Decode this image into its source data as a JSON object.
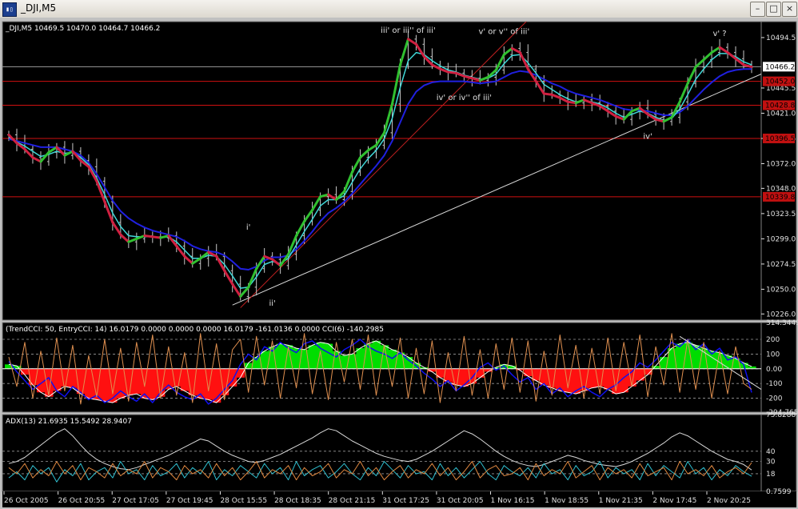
{
  "window": {
    "title": "_DJI,M5",
    "icon": "chart-window-icon",
    "buttons": [
      {
        "name": "minimize-button",
        "glyph": "–"
      },
      {
        "name": "maximize-button",
        "glyph": "□"
      },
      {
        "name": "close-button",
        "glyph": "×"
      }
    ]
  },
  "colors": {
    "background": "#000000",
    "grid": "#9a9a9a",
    "axis_text": "#e0e0e0",
    "price_bars": "#c8c8c8",
    "ma_blue": "#2020e0",
    "ma_cyan": "#40d8d8",
    "trend_up": "#30c030",
    "trend_down": "#d02040",
    "hline": "#d01010",
    "label_red_bg": "#c01010",
    "cci_green": "#00dd00",
    "cci_red": "#ff1010",
    "cci_blue": "#1010ee",
    "cci_orange": "#e09050",
    "adx_white": "#d8d8d8",
    "adx_cyan": "#30c0d0",
    "adx_orange": "#e08840",
    "trendline_red": "#c02020",
    "trendline_white": "#d8d8d8"
  },
  "chart_data": [
    {
      "type": "candlestick",
      "panel": "price",
      "title": "_DJI,M5  10469.5 10470.0 10464.7 10466.2",
      "ylim": [
        10220,
        10510
      ],
      "y_ticks": [
        10494.5,
        10445.5,
        10421.0,
        10396.5,
        10372.0,
        10348.0,
        10323.5,
        10299.0,
        10274.5,
        10250.0,
        10226.0
      ],
      "current_price": 10466.2,
      "price_lines": [
        {
          "value": 10452.0,
          "label": "10452.0"
        },
        {
          "value": 10428.8,
          "label": "10428.8"
        },
        {
          "value": 10396.5,
          "label": "10396.5"
        },
        {
          "value": 10339.8,
          "label": "10339.8"
        }
      ],
      "close": [
        10400,
        10392,
        10386,
        10378,
        10374,
        10383,
        10388,
        10380,
        10384,
        10375,
        10369,
        10355,
        10335,
        10315,
        10303,
        10296,
        10299,
        10302,
        10301,
        10300,
        10302,
        10292,
        10282,
        10275,
        10280,
        10286,
        10282,
        10268,
        10255,
        10243,
        10252,
        10270,
        10282,
        10279,
        10273,
        10284,
        10302,
        10316,
        10327,
        10340,
        10342,
        10337,
        10345,
        10364,
        10378,
        10385,
        10390,
        10402,
        10430,
        10468,
        10493,
        10488,
        10476,
        10468,
        10464,
        10461,
        10460,
        10457,
        10455,
        10453,
        10456,
        10463,
        10478,
        10484,
        10480,
        10464,
        10452,
        10440,
        10439,
        10436,
        10432,
        10431,
        10434,
        10431,
        10428,
        10423,
        10418,
        10415,
        10423,
        10426,
        10420,
        10415,
        10413,
        10417,
        10432,
        10450,
        10466,
        10473,
        10480,
        10485,
        10480,
        10474,
        10468,
        10466
      ],
      "ma_blue": [
        10396,
        10394,
        10392,
        10390,
        10388,
        10388,
        10388,
        10386,
        10384,
        10380,
        10373,
        10362,
        10349,
        10336,
        10326,
        10319,
        10314,
        10310,
        10307,
        10305,
        10303,
        10301,
        10297,
        10292,
        10289,
        10287,
        10286,
        10283,
        10277,
        10270,
        10269,
        10272,
        10278,
        10281,
        10281,
        10283,
        10289,
        10297,
        10306,
        10316,
        10324,
        10329,
        10335,
        10343,
        10352,
        10361,
        10370,
        10380,
        10394,
        10412,
        10430,
        10442,
        10448,
        10451,
        10452,
        10452,
        10452,
        10452,
        10451,
        10450,
        10451,
        10452,
        10456,
        10460,
        10462,
        10461,
        10458,
        10454,
        10450,
        10447,
        10443,
        10440,
        10438,
        10436,
        10434,
        10431,
        10428,
        10425,
        10424,
        10424,
        10423,
        10421,
        10419,
        10419,
        10422,
        10428,
        10436,
        10444,
        10451,
        10457,
        10461,
        10463,
        10464,
        10464
      ],
      "ma_cyan": [
        10398,
        10393,
        10389,
        10384,
        10379,
        10381,
        10384,
        10382,
        10383,
        10378,
        10371,
        10358,
        10342,
        10324,
        10311,
        10302,
        10301,
        10301,
        10301,
        10300,
        10301,
        10296,
        10288,
        10280,
        10280,
        10283,
        10282,
        10274,
        10263,
        10251,
        10252,
        10262,
        10274,
        10277,
        10275,
        10280,
        10293,
        10306,
        10318,
        10331,
        10337,
        10337,
        10341,
        10354,
        10367,
        10377,
        10385,
        10396,
        10416,
        10446,
        10472,
        10480,
        10478,
        10472,
        10467,
        10463,
        10461,
        10458,
        10456,
        10454,
        10455,
        10459,
        10469,
        10477,
        10478,
        10470,
        10460,
        10449,
        10444,
        10439,
        10435,
        10432,
        10433,
        10432,
        10430,
        10426,
        10421,
        10417,
        10420,
        10423,
        10421,
        10417,
        10414,
        10416,
        10425,
        10439,
        10454,
        10464,
        10473,
        10479,
        10479,
        10476,
        10471,
        10468
      ]
    },
    {
      "type": "area",
      "panel": "cci",
      "title": "(TrendCCI: 50, EntryCCI: 14)  16.0179 0.0000 0.0000 0.0000 16.0179 -161.0136 0.0000  CCI(6) -140.2985",
      "ylim": [
        -294.765,
        314.3449
      ],
      "y_ticks": [
        314.3449,
        200,
        100,
        0.0,
        -100,
        -200,
        -294.765
      ],
      "tick_labels": [
        "314.3449",
        "200",
        "100",
        "0.00",
        "-100",
        "-200",
        "-294.765"
      ],
      "trend_cci": [
        30,
        20,
        -40,
        -110,
        -160,
        -190,
        -150,
        -120,
        -130,
        -170,
        -200,
        -210,
        -220,
        -230,
        -200,
        -180,
        -170,
        -200,
        -210,
        -190,
        -140,
        -120,
        -150,
        -180,
        -200,
        -210,
        -230,
        -180,
        -120,
        -60,
        40,
        80,
        120,
        150,
        170,
        160,
        140,
        130,
        160,
        180,
        170,
        120,
        90,
        100,
        140,
        170,
        190,
        160,
        130,
        110,
        80,
        40,
        10,
        -20,
        -60,
        -90,
        -110,
        -120,
        -100,
        -60,
        -20,
        10,
        30,
        20,
        -10,
        -50,
        -80,
        -110,
        -130,
        -150,
        -160,
        -170,
        -150,
        -130,
        -120,
        -140,
        -170,
        -160,
        -120,
        -80,
        -40,
        20,
        80,
        140,
        170,
        180,
        160,
        140,
        120,
        110,
        90,
        70,
        40,
        16
      ],
      "entry_cci": [
        50,
        -20,
        -80,
        -140,
        -100,
        -60,
        -150,
        -190,
        -120,
        -160,
        -210,
        -180,
        -230,
        -200,
        -150,
        -190,
        -220,
        -170,
        -230,
        -160,
        -110,
        -160,
        -190,
        -210,
        -170,
        -240,
        -200,
        -140,
        -80,
        30,
        100,
        60,
        150,
        120,
        180,
        140,
        110,
        170,
        190,
        140,
        110,
        80,
        130,
        160,
        200,
        150,
        120,
        100,
        70,
        110,
        60,
        20,
        -30,
        -70,
        -120,
        -80,
        -150,
        -110,
        -60,
        10,
        40,
        -10,
        20,
        -40,
        -90,
        -60,
        -140,
        -100,
        -170,
        -130,
        -190,
        -150,
        -120,
        -160,
        -190,
        -140,
        -110,
        -60,
        -20,
        40,
        10,
        60,
        120,
        180,
        150,
        200,
        130,
        170,
        100,
        140,
        60,
        80,
        30,
        -161
      ],
      "cci6": [
        80,
        -120,
        180,
        -200,
        120,
        -180,
        210,
        -150,
        160,
        -240,
        90,
        -190,
        200,
        -170,
        140,
        -220,
        180,
        -120,
        230,
        -200,
        150,
        -180,
        110,
        -230,
        240,
        -150,
        170,
        -210,
        130,
        200,
        -160,
        220,
        -110,
        190,
        -200,
        150,
        -130,
        240,
        -170,
        120,
        -210,
        180,
        -90,
        200,
        -140,
        230,
        -180,
        160,
        -120,
        210,
        -200,
        140,
        -170,
        190,
        -230,
        110,
        -150,
        220,
        -180,
        130,
        -200,
        170,
        -140,
        210,
        -160,
        190,
        -220,
        120,
        -180,
        230,
        -130,
        160,
        -200,
        140,
        -170,
        210,
        -150,
        180,
        -120,
        230,
        -190,
        150,
        -110,
        240,
        -160,
        200,
        -140,
        180,
        -200,
        120,
        -170,
        150,
        -100,
        -140
      ]
    },
    {
      "type": "line",
      "panel": "adx",
      "title": "ADX(13) 21.6935 15.5492 28.9407",
      "ylim": [
        0.7599,
        75.8288
      ],
      "y_ticks": [
        75.8288,
        40,
        30,
        18,
        0.7599
      ],
      "tick_labels": [
        "75.8288",
        "40",
        "30",
        "18",
        "0.7599"
      ],
      "x_labels": [
        "26 Oct 2005",
        "26 Oct 20:55",
        "27 Oct 17:05",
        "27 Oct 19:45",
        "28 Oct 15:55",
        "28 Oct 18:35",
        "28 Oct 21:15",
        "31 Oct 17:25",
        "31 Oct 20:05",
        "1 Nov 16:15",
        "1 Nov 18:55",
        "1 Nov 21:35",
        "2 Nov 17:45",
        "2 Nov 20:25"
      ],
      "adx": [
        28,
        30,
        34,
        40,
        46,
        52,
        58,
        62,
        55,
        46,
        38,
        32,
        28,
        25,
        23,
        22,
        24,
        27,
        30,
        33,
        36,
        40,
        44,
        48,
        52,
        50,
        45,
        40,
        36,
        33,
        30,
        29,
        31,
        34,
        37,
        41,
        45,
        49,
        53,
        58,
        62,
        60,
        55,
        50,
        46,
        42,
        38,
        35,
        33,
        31,
        30,
        32,
        36,
        40,
        45,
        50,
        55,
        60,
        57,
        52,
        46,
        40,
        35,
        31,
        28,
        26,
        25,
        27,
        30,
        33,
        36,
        34,
        31,
        29,
        27,
        26,
        25,
        27,
        30,
        34,
        38,
        43,
        48,
        54,
        58,
        55,
        50,
        45,
        40,
        36,
        32,
        30,
        27,
        21.7
      ],
      "plus_di": [
        14,
        20,
        12,
        26,
        18,
        24,
        10,
        22,
        16,
        28,
        12,
        20,
        24,
        14,
        30,
        18,
        22,
        12,
        26,
        16,
        20,
        28,
        14,
        24,
        18,
        30,
        12,
        22,
        16,
        26,
        20,
        14,
        28,
        18,
        24,
        12,
        30,
        16,
        22,
        26,
        14,
        20,
        28,
        18,
        12,
        24,
        16,
        30,
        22,
        14,
        26,
        18,
        20,
        12,
        28,
        16,
        24,
        14,
        22,
        30,
        18,
        12,
        26,
        20,
        16,
        24,
        14,
        28,
        18,
        22,
        12,
        26,
        16,
        20,
        30,
        14,
        24,
        18,
        22,
        12,
        28,
        16,
        26,
        20,
        14,
        30,
        18,
        24,
        12,
        22,
        16,
        26,
        20,
        15.5
      ],
      "minus_di": [
        24,
        18,
        28,
        14,
        22,
        16,
        30,
        18,
        26,
        12,
        24,
        20,
        14,
        28,
        16,
        22,
        18,
        30,
        14,
        24,
        20,
        12,
        26,
        18,
        22,
        14,
        28,
        16,
        24,
        12,
        20,
        30,
        14,
        22,
        18,
        26,
        12,
        24,
        16,
        20,
        28,
        14,
        22,
        18,
        30,
        16,
        24,
        12,
        20,
        26,
        14,
        22,
        18,
        28,
        16,
        24,
        12,
        20,
        30,
        14,
        22,
        26,
        16,
        18,
        24,
        12,
        28,
        16,
        22,
        18,
        30,
        14,
        20,
        26,
        12,
        24,
        18,
        22,
        14,
        28,
        16,
        20,
        24,
        12,
        30,
        18,
        22,
        16,
        26,
        14,
        20,
        24,
        18,
        28.9
      ]
    }
  ],
  "annotations": {
    "wave_labels": [
      {
        "text": "iii' or iii'' of iii'",
        "bar": 50,
        "value": 10499
      },
      {
        "text": "v' or v'' of iii'",
        "bar": 62,
        "value": 10498
      },
      {
        "text": "iv' or iv'' of iii'",
        "bar": 57,
        "value": 10434
      },
      {
        "text": "v' ?",
        "bar": 89,
        "value": 10496
      },
      {
        "text": "i'",
        "bar": 30,
        "value": 10308
      },
      {
        "text": "ii'",
        "bar": 33,
        "value": 10234
      },
      {
        "text": "iv'",
        "bar": 80,
        "value": 10396
      }
    ]
  }
}
